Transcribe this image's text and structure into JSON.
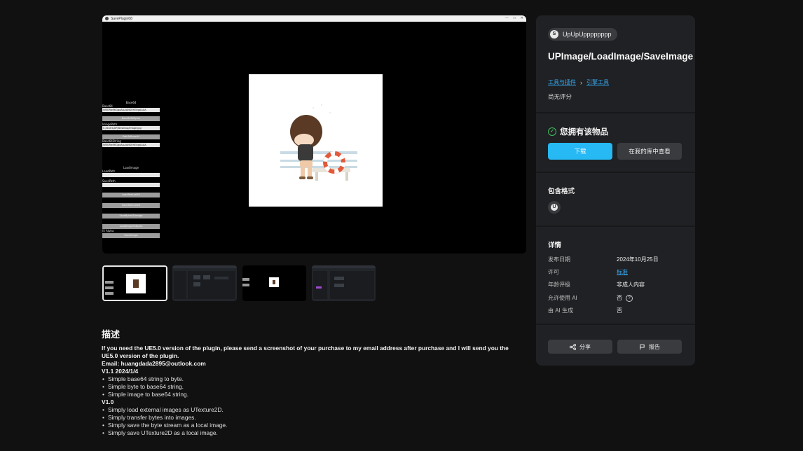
{
  "viewer": {
    "window_title": "SavePlugin68",
    "win_controls": [
      "—",
      "□",
      "✕"
    ],
    "base64_section": {
      "header": "Base64",
      "base64_label": "Base64",
      "base64_value": "iVBORw0KGgoAAAANSUhEUgAAAA",
      "btn_base64_to_bytes": "Base64ToBytes",
      "imagepath_label": "ImagePath",
      "imagepath_value": "C:/Users/UP/Desktop/image.jpg",
      "btn_path_to_base64": "PathToBase64",
      "base64string_label": "Base64String",
      "base64string_value": "iVBORw0KGgoAAAANSUhEUgAAAA"
    },
    "load_section": {
      "header": "LoadImage",
      "loadpath_label": "LoadPath",
      "savepath_label": "SavePath",
      "btn1": "LoadTexture2D",
      "btn2": "SaveTexture2D",
      "btn3": "SaveBytesToImage",
      "btn4": "LoadImageToBytes",
      "alpha_label": "IS Alpha",
      "btn5": "SaveImage"
    }
  },
  "description": {
    "heading": "描述",
    "line1": "If you need the UE5.0 version of the plugin, please send a screenshot of your purchase to my email address after purchase and I will send you the UE5.0 version of the plugin.",
    "email": "Email: huangdada2895@outlook.com",
    "v11_header": "V1.1 2024/1/4",
    "v11_items": [
      "Simple base64 string to byte.",
      "Simple byte to base64 string.",
      "Simple image to base64 string."
    ],
    "v10_header": "V1.0",
    "v10_items": [
      "Simply load external images as UTexture2D.",
      "Simply transfer bytes into images.",
      "Simply save the byte stream as a local image.",
      "Simply save UTexture2D as a local image."
    ]
  },
  "side": {
    "seller": "UpUpUpppppppp",
    "title": "UPImage/LoadImage/SaveImage",
    "crumb1": "工具与插件",
    "crumb2": "引擎工具",
    "rating": "尚无评分",
    "owned": "您拥有该物品",
    "download": "下载",
    "view_in_library": "在我的库中查看",
    "formats_title": "包含格式",
    "details_title": "详情",
    "details": [
      {
        "label": "发布日期",
        "value": "2024年10月25日"
      },
      {
        "label": "许可",
        "value": "标准"
      },
      {
        "label": "年龄评级",
        "value": "非成人内容"
      },
      {
        "label": "允许使用 AI",
        "value": "否"
      },
      {
        "label": "由 AI 生成",
        "value": "否"
      }
    ],
    "share": "分享",
    "report": "报告"
  },
  "colors": {
    "accent": "#26b9f4",
    "link": "#37a9f0",
    "owned_check": "#3fbf5f"
  }
}
